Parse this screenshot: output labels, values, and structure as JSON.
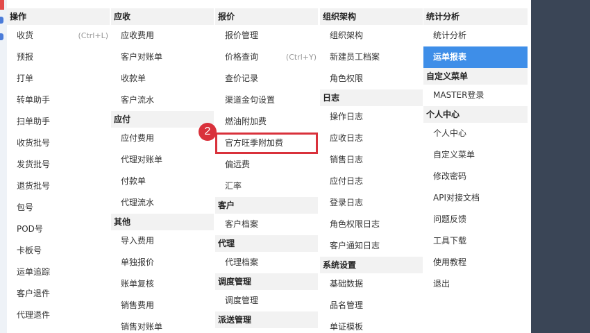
{
  "columns": [
    {
      "groups": [
        {
          "title": "操作",
          "items": [
            {
              "label": "收货",
              "shortcut": "(Ctrl+L)"
            },
            {
              "label": "预报"
            },
            {
              "label": "打单"
            },
            {
              "label": "转单助手"
            },
            {
              "label": "扫单助手"
            },
            {
              "label": "收货批号"
            },
            {
              "label": "发货批号"
            },
            {
              "label": "退货批号"
            },
            {
              "label": "包号"
            },
            {
              "label": "POD号"
            },
            {
              "label": "卡板号"
            },
            {
              "label": "运单追踪"
            },
            {
              "label": "客户退件"
            },
            {
              "label": "代理退件"
            }
          ]
        }
      ]
    },
    {
      "groups": [
        {
          "title": "应收",
          "items": [
            {
              "label": "应收费用"
            },
            {
              "label": "客户对账单"
            },
            {
              "label": "收款单"
            },
            {
              "label": "客户流水"
            }
          ]
        },
        {
          "title": "应付",
          "items": [
            {
              "label": "应付费用"
            },
            {
              "label": "代理对账单"
            },
            {
              "label": "付款单"
            },
            {
              "label": "代理流水"
            }
          ]
        },
        {
          "title": "其他",
          "items": [
            {
              "label": "导入费用"
            },
            {
              "label": "单独报价"
            },
            {
              "label": "账单复核"
            },
            {
              "label": "销售费用"
            },
            {
              "label": "销售对账单"
            }
          ]
        }
      ]
    },
    {
      "groups": [
        {
          "title": "报价",
          "items": [
            {
              "label": "报价管理"
            },
            {
              "label": "价格查询",
              "shortcut": "(Ctrl+Y)"
            },
            {
              "label": "查价记录"
            },
            {
              "label": "渠道金句设置"
            },
            {
              "label": "燃油附加费"
            },
            {
              "label": "官方旺季附加费",
              "highlight": true
            },
            {
              "label": "偏远费"
            },
            {
              "label": "汇率"
            }
          ]
        },
        {
          "title": "客户",
          "items": [
            {
              "label": "客户档案"
            }
          ]
        },
        {
          "title": "代理",
          "items": [
            {
              "label": "代理档案"
            }
          ]
        },
        {
          "title": "调度管理",
          "items": [
            {
              "label": "调度管理"
            }
          ]
        },
        {
          "title": "派送管理",
          "items": []
        }
      ]
    },
    {
      "groups": [
        {
          "title": "组织架构",
          "items": [
            {
              "label": "组织架构"
            },
            {
              "label": "新建员工档案"
            },
            {
              "label": "角色权限"
            }
          ]
        },
        {
          "title": "日志",
          "items": [
            {
              "label": "操作日志"
            },
            {
              "label": "应收日志"
            },
            {
              "label": "销售日志"
            },
            {
              "label": "应付日志"
            },
            {
              "label": "登录日志"
            },
            {
              "label": "角色权限日志"
            },
            {
              "label": "客户通知日志"
            }
          ]
        },
        {
          "title": "系统设置",
          "items": [
            {
              "label": "基础数据"
            },
            {
              "label": "品名管理"
            },
            {
              "label": "单证模板"
            }
          ]
        }
      ]
    },
    {
      "groups": [
        {
          "title": "统计分析",
          "items": [
            {
              "label": "统计分析"
            },
            {
              "label": "运单报表",
              "active": true
            }
          ]
        },
        {
          "title": "自定义菜单",
          "items": [
            {
              "label": "MASTER登录"
            }
          ]
        },
        {
          "title": "个人中心",
          "items": [
            {
              "label": "个人中心"
            },
            {
              "label": "自定义菜单"
            },
            {
              "label": "修改密码"
            },
            {
              "label": "API对接文档"
            },
            {
              "label": "问题反馈"
            },
            {
              "label": "工具下载"
            },
            {
              "label": "使用教程"
            },
            {
              "label": "退出"
            }
          ]
        }
      ]
    }
  ],
  "annotation": {
    "step": "2"
  },
  "colors": {
    "active_bg": "#3e8ee8",
    "highlight_border": "#d9313b",
    "header_bg": "#f2f2f2",
    "right_panel": "#3a4556"
  }
}
